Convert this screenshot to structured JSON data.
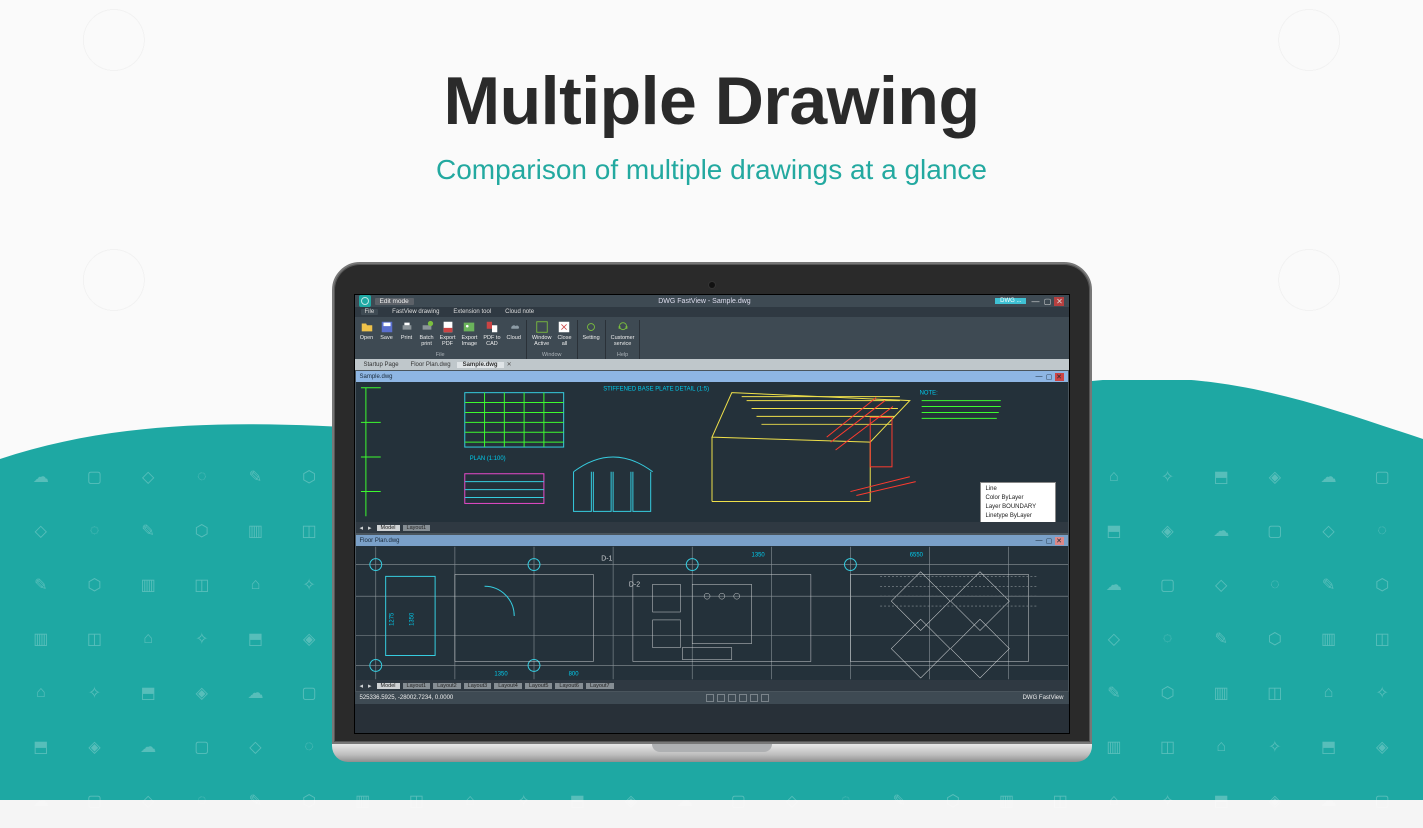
{
  "page": {
    "headline": "Multiple Drawing",
    "subheadline": "Comparison of multiple drawings at a glance"
  },
  "app": {
    "mode_button": "Edit mode",
    "window_title": "DWG FastView - Sample.dwg",
    "dwg_badge": "DWG ...",
    "brand": "DWG FastView",
    "menubar": [
      "File",
      "FastView drawing",
      "Extension tool",
      "Cloud note"
    ],
    "ribbon": {
      "file": {
        "label": "File",
        "items": [
          "Open",
          "Save",
          "Print",
          "Batch\nprint",
          "Export\nPDF",
          "Export\nImage",
          "PDF to\nCAD",
          "Cloud"
        ]
      },
      "window": {
        "label": "Window",
        "items": [
          "Window\nActive",
          "Close\nall"
        ]
      },
      "settings": {
        "label": "",
        "items": [
          "Setting"
        ]
      },
      "help": {
        "label": "Help",
        "items": [
          "Customer\nservice"
        ]
      }
    },
    "doc_tabs": [
      "Startup Page",
      "Floor Plan.dwg",
      "Sample.dwg"
    ],
    "doc_tabs_active": 2,
    "pane1": {
      "title": "Sample.dwg",
      "annot1": "STIFFENED BASE\nPLATE DETAIL (1:5)",
      "annot_plan": "PLAN (1:100)",
      "note_label": "NOTE:",
      "model_tabs": [
        "Model",
        "Layout1"
      ],
      "tooltip": {
        "type": "Line",
        "color": "Color  ByLayer",
        "layer": "Layer  BOUNDARY",
        "linetype": "Linetype  ByLayer"
      }
    },
    "pane2": {
      "title": "Floor Plan.dwg",
      "dims": {
        "d1": "D-1",
        "d2": "D-2",
        "a": "1350",
        "b": "1350",
        "c": "800",
        "d": "6550",
        "v1": "1275",
        "v2": "1350"
      },
      "model_tabs": [
        "Model",
        "Layout1",
        "Layout2",
        "Layout3",
        "Layout4",
        "Layout5",
        "Layout6",
        "Layout7"
      ]
    },
    "statusbar": {
      "coords": "525336.5925, -28002.7234, 0.0000"
    }
  }
}
